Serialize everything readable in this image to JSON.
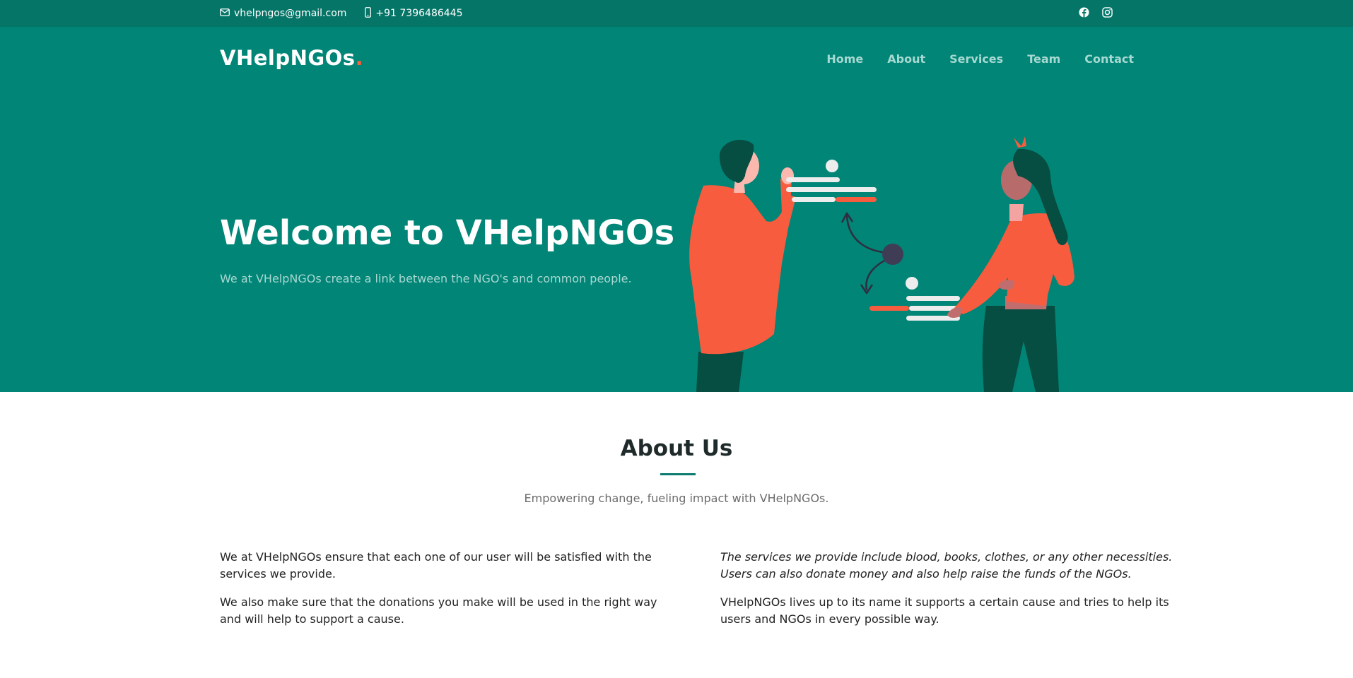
{
  "topbar": {
    "email": "vhelpngos@gmail.com",
    "phone": "+91 7396486445",
    "social": [
      "facebook-icon",
      "instagram-icon"
    ]
  },
  "brand": {
    "name": "VHelpNGOs",
    "dot": ".",
    "accent_color": "#ff5e3a"
  },
  "nav": {
    "items": [
      {
        "label": "Home"
      },
      {
        "label": "About"
      },
      {
        "label": "Services"
      },
      {
        "label": "Team"
      },
      {
        "label": "Contact"
      }
    ]
  },
  "hero": {
    "title": "Welcome to VHelpNGOs",
    "subtitle": "We at VHelpNGOs create a link between the NGO's and common people.",
    "background_color": "#008577"
  },
  "about": {
    "title": "About Us",
    "subtitle": "Empowering change, fueling impact with VHelpNGOs.",
    "left": [
      "We at VHelpNGOs ensure that each one of our user will be satisfied with the services we provide.",
      "We also make sure that the donations you make will be used in the right way and will help to support a cause."
    ],
    "right": [
      "The services we provide include blood, books, clothes, or any other necessities. Users can also donate money and also help raise the funds of the NGOs.",
      "VHelpNGOs lives up to its name it supports a certain cause and tries to help its users and NGOs in every possible way."
    ]
  }
}
